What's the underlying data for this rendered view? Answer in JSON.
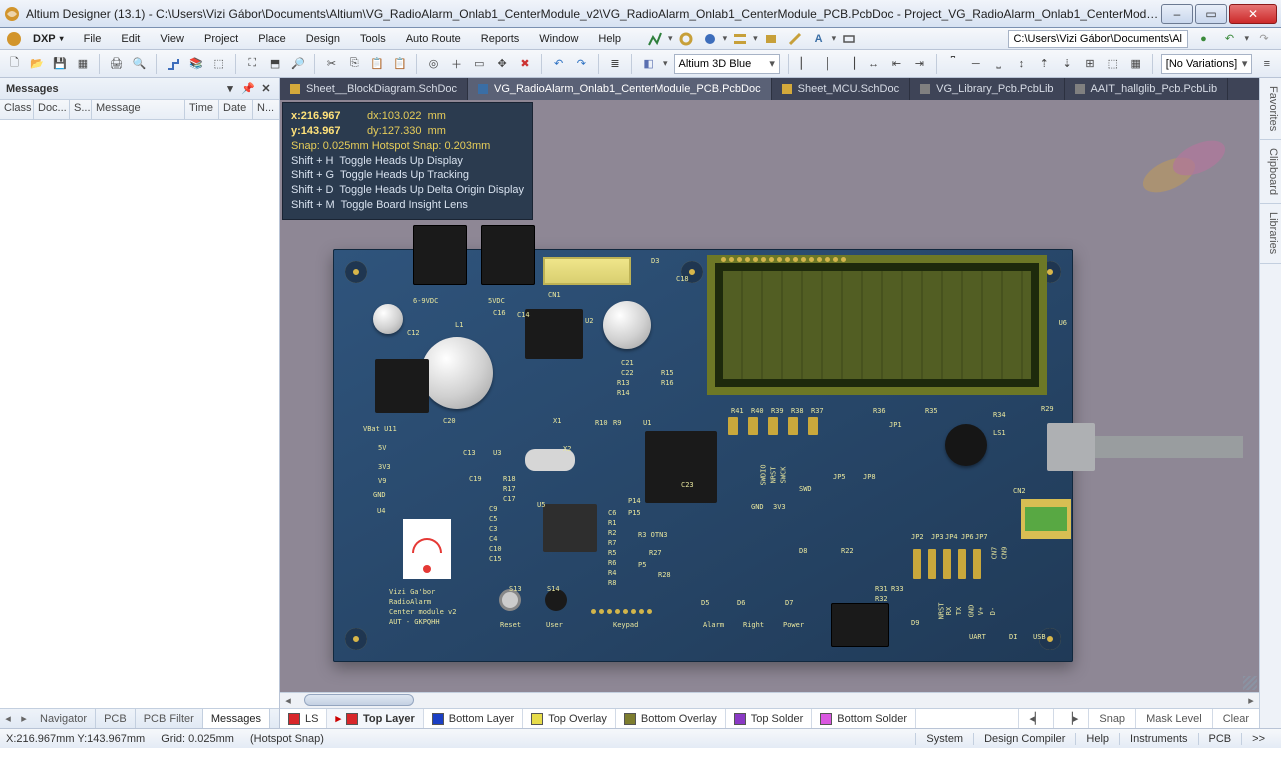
{
  "window": {
    "title": "Altium Designer (13.1) - C:\\Users\\Vizi Gábor\\Documents\\Altium\\VG_RadioAlarm_Onlab1_CenterModule_v2\\VG_RadioAlarm_Onlab1_CenterModule_PCB.PcbDoc - Project_VG_RadioAlarm_Onlab1_CenterModule_v2.Pr..."
  },
  "menu": [
    "DXP",
    "File",
    "Edit",
    "View",
    "Project",
    "Place",
    "Design",
    "Tools",
    "Auto Route",
    "Reports",
    "Window",
    "Help"
  ],
  "address_path": "C:\\Users\\Vizi Gábor\\Documents\\Al",
  "view_mode": "Altium 3D Blue",
  "variations": "[No Variations]",
  "messages": {
    "title": "Messages",
    "columns": [
      "Class",
      "Doc...",
      "S...",
      "Message",
      "Time",
      "Date",
      "N..."
    ],
    "bottom_tabs": [
      "Navigator",
      "PCB",
      "PCB Filter",
      "Messages"
    ],
    "active_bottom_tab": 3
  },
  "doc_tabs": [
    {
      "label": "Sheet__BlockDiagram.SchDoc",
      "color": "#d4a93b",
      "active": false
    },
    {
      "label": "VG_RadioAlarm_Onlab1_CenterModule_PCB.PcbDoc",
      "color": "#3a6ea5",
      "active": true
    },
    {
      "label": "Sheet_MCU.SchDoc",
      "color": "#d4a93b",
      "active": false
    },
    {
      "label": "VG_Library_Pcb.PcbLib",
      "color": "#808080",
      "active": false
    },
    {
      "label": "AAIT_hallglib_Pcb.PcbLib",
      "color": "#808080",
      "active": false
    }
  ],
  "hud": {
    "x": "x:216.967",
    "dx": "dx:103.022  mm",
    "y": "y:143.967",
    "dy": "dy:127.330  mm",
    "snap": "Snap: 0.025mm Hotspot Snap: 0.203mm",
    "lines": [
      "Shift + H  Toggle Heads Up Display",
      "Shift + G  Toggle Heads Up Tracking",
      "Shift + D  Toggle Heads Up Delta Origin Display",
      "Shift + M  Toggle Board Insight Lens"
    ]
  },
  "silk": {
    "pwr1": "6-9VDC",
    "pwr2": "5VDC",
    "cn1": "CN1",
    "c12": "C12",
    "d3": "D3",
    "c18": "C18",
    "u6": "U6",
    "c16": "C16",
    "c14": "C14",
    "u2": "U2",
    "l1": "L1",
    "u4": "U4",
    "r13": "R13",
    "r14": "R14",
    "r10": "R10",
    "c21": "C21",
    "c22": "C22",
    "r15": "R15",
    "r16": "R16",
    "vbat": "VBat U11",
    "5v": "5V",
    "3v3": "3V3",
    "v9": "V9",
    "gnd": "GND",
    "c13": "C13",
    "u3": "U3",
    "c20": "C20",
    "x1": "X1",
    "r9": "R9",
    "u1": "U1",
    "x2": "X2",
    "c19": "C19",
    "r18": "R18",
    "r17": "R17",
    "c17": "C17",
    "c23": "C23",
    "r41": "R41",
    "r40": "R40",
    "r39": "R39",
    "r38": "R38",
    "r37": "R37",
    "r36": "R36",
    "r35": "R35",
    "r34": "R34",
    "r29": "R29",
    "ls1": "LS1",
    "jp1": "JP1",
    "jp5": "JP5",
    "jp8": "JP8",
    "cn2": "CN2",
    "u5": "U5",
    "c6": "C6",
    "swd": "SWD",
    "swdio": "SWDIO",
    "nrst": "NRST",
    "gnd2": "GND",
    "3v3b": "3V3",
    "swck": "SWCK",
    "p15": "P15",
    "p14": "P14",
    "cn7": "CN7",
    "cn9": "CN9",
    "c9": "C9",
    "c5": "C5",
    "c3": "C3",
    "c4": "C4",
    "c10": "C10",
    "c15": "C15",
    "r1": "R1",
    "r2": "R2",
    "r7": "R7",
    "r3": "R3 OTN3",
    "r5": "R5",
    "r6": "R6",
    "r4": "R4",
    "r8": "R8",
    "r27": "R27",
    "r28": "R28",
    "ps": "P5",
    "d8": "D8",
    "r22": "R22",
    "jp2": "JP2",
    "jp3": "JP3",
    "jp4": "JP4",
    "jp6": "JP6",
    "jp7": "JP7",
    "author1": "Vizi Ga'bor",
    "author2": "RadioAlarm",
    "author3": "Center module v2",
    "author4": "AUT - GKPQHH",
    "s13": "S13",
    "s14": "S14",
    "reset": "Reset",
    "user": "User",
    "keypad": "Keypad",
    "d5": "D5",
    "d6": "D6",
    "d7": "D7",
    "alarm": "Alarm",
    "right": "Right",
    "power": "Power",
    "r31": "R31",
    "r32": "R32",
    "r33": "R33",
    "d9": "D9",
    "nrst2": "NRST",
    "rx": "RX",
    "tx": "TX",
    "gnd3": "GND",
    "vp": "V+",
    "dm": "D-",
    "uart": "UART",
    "di": "DI",
    "usb": "USB"
  },
  "layers": {
    "ls": "LS",
    "tabs": [
      {
        "label": "Top Layer",
        "color": "#d8262a",
        "active": true
      },
      {
        "label": "Bottom Layer",
        "color": "#1b3fc4",
        "active": false
      },
      {
        "label": "Top Overlay",
        "color": "#e7dc4a",
        "active": false
      },
      {
        "label": "Bottom Overlay",
        "color": "#7d7d2f",
        "active": false
      },
      {
        "label": "Top Solder",
        "color": "#8a39c4",
        "active": false
      },
      {
        "label": "Bottom Solder",
        "color": "#d957e0",
        "active": false
      }
    ],
    "right": [
      "Snap",
      "Mask Level",
      "Clear"
    ]
  },
  "status": {
    "coords": "X:216.967mm Y:143.967mm",
    "grid": "Grid: 0.025mm",
    "snap": "(Hotspot Snap)",
    "right": [
      "System",
      "Design Compiler",
      "Help",
      "Instruments",
      "PCB",
      ">>"
    ]
  },
  "vtabs": [
    "Favorites",
    "Clipboard",
    "Libraries"
  ]
}
